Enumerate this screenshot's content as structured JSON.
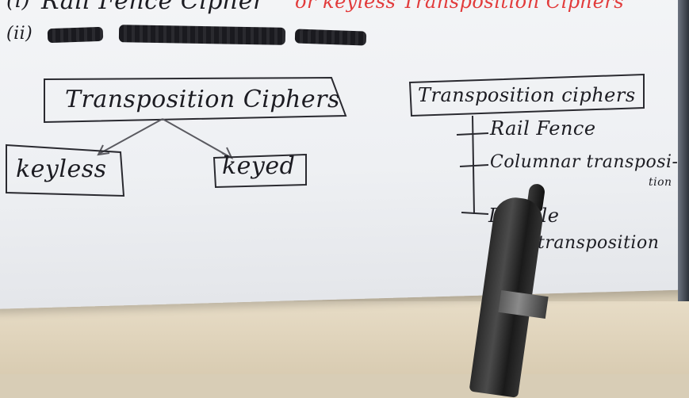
{
  "header": {
    "line1_marker": "(i)",
    "line1_text": "Rail Fence Cipher",
    "line1_red": "or keyless Transposition Ciphers",
    "line2_marker": "(ii)"
  },
  "left_tree": {
    "root": "Transposition Ciphers",
    "left_child": "keyless",
    "right_child": "keyed"
  },
  "right_tree": {
    "root": "Transposition ciphers",
    "items": [
      "Rail Fence",
      "Columnar transposi-",
      "tion",
      "Double",
      "transposition"
    ]
  },
  "colors": {
    "ink": "#1c1c22",
    "red_ink": "#e23b3b",
    "paper": "#f1f2f5",
    "table": "#d8cdb6"
  }
}
